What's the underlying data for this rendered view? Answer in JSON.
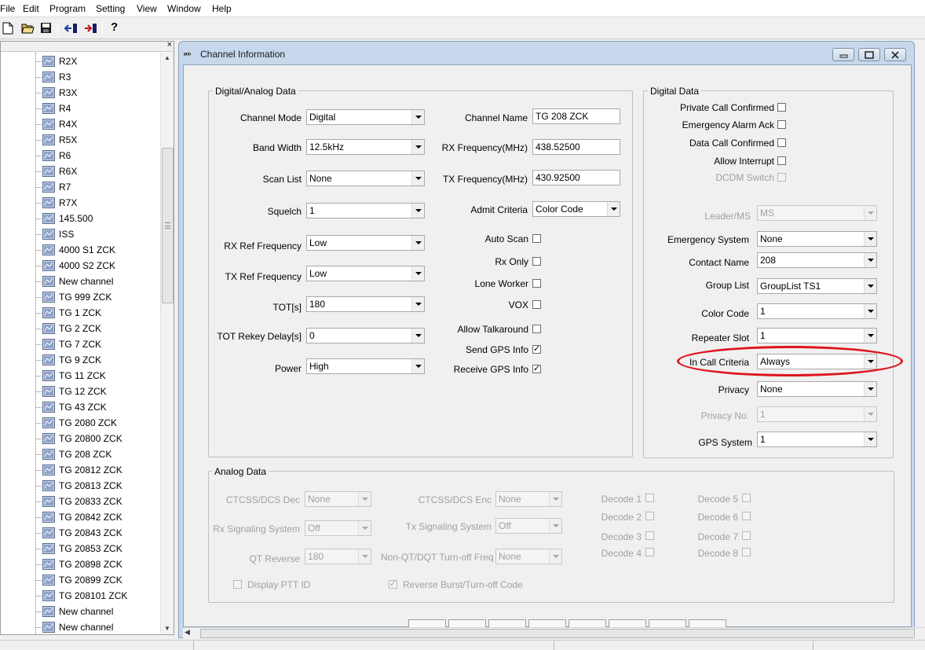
{
  "menu": [
    "File",
    "Edit",
    "Program",
    "Setting",
    "View",
    "Window",
    "Help"
  ],
  "toolbar": {
    "icons": [
      "new-file-icon",
      "open-folder-icon",
      "save-icon",
      "read-from-radio-icon",
      "write-to-radio-icon",
      "help-icon"
    ],
    "help_glyph": "?"
  },
  "tree": {
    "close_glyph": "×",
    "items": [
      "R2X",
      "R3",
      "R3X",
      "R4",
      "R4X",
      "R5X",
      "R6",
      "R6X",
      "R7",
      "R7X",
      "145.500",
      "ISS",
      "4000 S1 ZCK",
      "4000 S2 ZCK",
      "New channel",
      "TG 999 ZCK",
      "TG 1 ZCK",
      "TG 2 ZCK",
      "TG 7 ZCK",
      "TG 9 ZCK",
      "TG 11 ZCK",
      "TG 12 ZCK",
      "TG 43 ZCK",
      "TG 2080  ZCK",
      "TG 20800 ZCK",
      "TG 208 ZCK",
      "TG 20812 ZCK",
      "TG 20813 ZCK",
      "TG 20833 ZCK",
      "TG 20842 ZCK",
      "TG 20843 ZCK",
      "TG 20853 ZCK",
      "TG 20898 ZCK",
      "TG 20899 ZCK",
      "TG 208101 ZCK",
      "New channel",
      "New channel"
    ]
  },
  "window": {
    "icon_text": "ₚₒₒ",
    "title": "Channel Information"
  },
  "digital_analog": {
    "title": "Digital/Analog Data",
    "channel_mode": {
      "label": "Channel Mode",
      "value": "Digital"
    },
    "band_width": {
      "label": "Band Width",
      "value": "12.5kHz"
    },
    "scan_list": {
      "label": "Scan List",
      "value": "None"
    },
    "squelch": {
      "label": "Squelch",
      "value": "1"
    },
    "rx_ref": {
      "label": "RX Ref Frequency",
      "value": "Low"
    },
    "tx_ref": {
      "label": "TX Ref Frequency",
      "value": "Low"
    },
    "tot": {
      "label": "TOT[s]",
      "value": "180"
    },
    "tot_rekey": {
      "label": "TOT Rekey Delay[s]",
      "value": "0"
    },
    "power": {
      "label": "Power",
      "value": "High"
    },
    "channel_name": {
      "label": "Channel Name",
      "value": "TG 208 ZCK"
    },
    "rx_freq": {
      "label": "RX Frequency(MHz)",
      "value": "438.52500"
    },
    "tx_freq": {
      "label": "TX Frequency(MHz)",
      "value": "430.92500"
    },
    "admit_criteria": {
      "label": "Admit Criteria",
      "value": "Color Code"
    },
    "auto_scan": {
      "label": "Auto Scan",
      "checked": false
    },
    "rx_only": {
      "label": "Rx Only",
      "checked": false
    },
    "lone_worker": {
      "label": "Lone Worker",
      "checked": false
    },
    "vox": {
      "label": "VOX",
      "checked": false
    },
    "allow_talkaround": {
      "label": "Allow Talkaround",
      "checked": false
    },
    "send_gps": {
      "label": "Send GPS Info",
      "checked": true
    },
    "receive_gps": {
      "label": "Receive GPS Info",
      "checked": true
    }
  },
  "digital": {
    "title": "Digital Data",
    "private_call": {
      "label": "Private Call Confirmed",
      "checked": false
    },
    "emergency_ack": {
      "label": "Emergency Alarm Ack",
      "checked": false
    },
    "data_call": {
      "label": "Data Call Confirmed",
      "checked": false
    },
    "allow_interrupt": {
      "label": "Allow Interrupt",
      "checked": false
    },
    "dcdm": {
      "label": "DCDM Switch",
      "checked": false
    },
    "leader_ms": {
      "label": "Leader/MS",
      "value": "MS"
    },
    "emergency_system": {
      "label": "Emergency System",
      "value": "None"
    },
    "contact_name": {
      "label": "Contact Name",
      "value": "208"
    },
    "group_list": {
      "label": "Group List",
      "value": "GroupList TS1"
    },
    "color_code": {
      "label": "Color Code",
      "value": "1"
    },
    "repeater_slot": {
      "label": "Repeater Slot",
      "value": "1"
    },
    "in_call_criteria": {
      "label": "In Call Criteria",
      "value": "Always"
    },
    "privacy": {
      "label": "Privacy",
      "value": "None"
    },
    "privacy_no": {
      "label": "Privacy No.",
      "value": "1"
    },
    "gps_system": {
      "label": "GPS System",
      "value": "1"
    }
  },
  "analog": {
    "title": "Analog Data",
    "ctcss_dec": {
      "label": "CTCSS/DCS Dec",
      "value": "None"
    },
    "ctcss_enc": {
      "label": "CTCSS/DCS Enc",
      "value": "None"
    },
    "rx_signaling": {
      "label": "Rx Signaling System",
      "value": "Off"
    },
    "tx_signaling": {
      "label": "Tx Signaling System",
      "value": "Off"
    },
    "qt_reverse": {
      "label": "QT Reverse",
      "value": "180"
    },
    "non_qt": {
      "label": "Non-QT/DQT Turn-off Freq",
      "value": "None"
    },
    "display_ptt": {
      "label": "Display PTT ID",
      "checked": false
    },
    "reverse_burst": {
      "label": "Reverse Burst/Turn-off Code",
      "checked": true
    },
    "decodes": [
      "Decode 1",
      "Decode 2",
      "Decode 3",
      "Decode 4",
      "Decode 5",
      "Decode 6",
      "Decode 7",
      "Decode 8"
    ]
  },
  "colors": {
    "annotation": "#e0141e",
    "frame": "#c7d8ec"
  }
}
